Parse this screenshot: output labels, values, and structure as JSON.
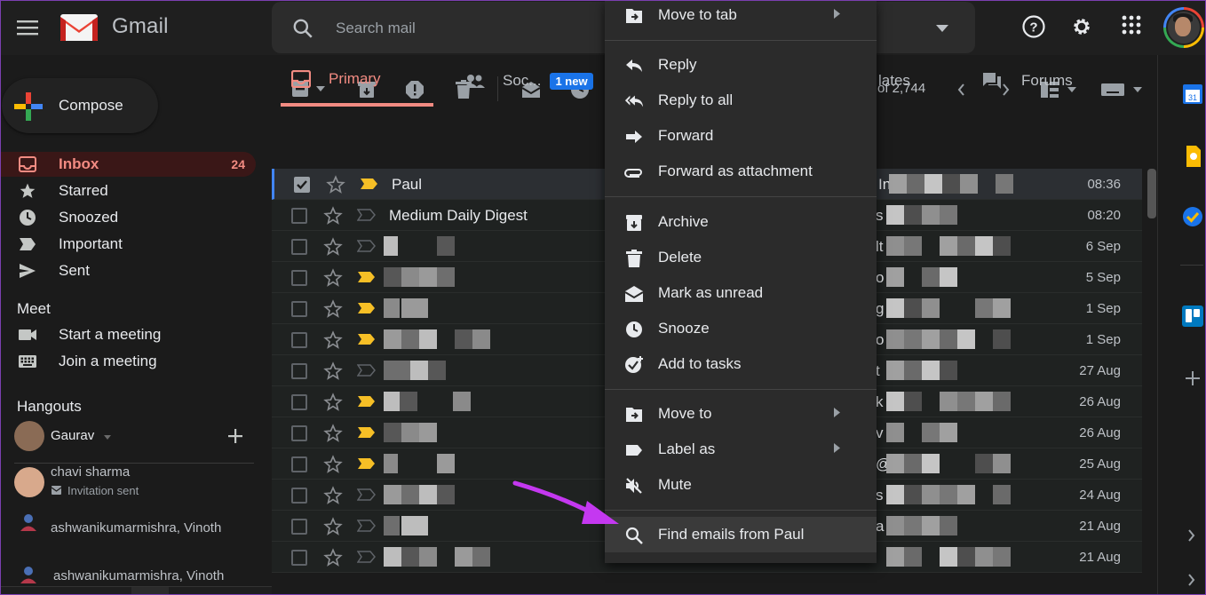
{
  "header": {
    "app_name": "Gmail",
    "search_placeholder": "Search mail"
  },
  "sidebar": {
    "compose_label": "Compose",
    "items": [
      {
        "label": "Inbox",
        "count": "24",
        "icon": "inbox-icon"
      },
      {
        "label": "Starred",
        "icon": "star-icon"
      },
      {
        "label": "Snoozed",
        "icon": "clock-icon"
      },
      {
        "label": "Important",
        "icon": "important-icon"
      },
      {
        "label": "Sent",
        "icon": "send-icon"
      }
    ],
    "meet": {
      "title": "Meet",
      "start": "Start a meeting",
      "join": "Join a meeting"
    },
    "hangouts": {
      "title": "Hangouts",
      "self": "Gaurav",
      "contacts": [
        {
          "name": "chavi sharma",
          "status": "Invitation sent"
        },
        {
          "name": "ashwanikumarmishra, Vinoth"
        },
        {
          "name": "ashwanikumarmishra, Vinoth"
        }
      ]
    }
  },
  "toolbar": {
    "page_count": "of 2,744"
  },
  "tabs": [
    {
      "label": "Primary",
      "active": true
    },
    {
      "label": "Soc...",
      "badge": "1 new"
    },
    {
      "label": "lates"
    },
    {
      "label": "Forums"
    }
  ],
  "emails": [
    {
      "sender": "Paul",
      "snippet_start": "In",
      "date": "08:36",
      "selected": true,
      "important": true
    },
    {
      "sender": "Medium Daily Digest",
      "snippet_start": "s",
      "date": "08:20",
      "important": false
    },
    {
      "sender": "",
      "snippet_start": "lt",
      "date": "6 Sep",
      "important": false
    },
    {
      "sender": "",
      "snippet_start": "o",
      "date": "5 Sep",
      "important": true
    },
    {
      "sender": "",
      "snippet_start": "g",
      "date": "1 Sep",
      "important": true
    },
    {
      "sender": "",
      "snippet_start": "o",
      "date": "1 Sep",
      "important": true
    },
    {
      "sender": "",
      "snippet_start": "t",
      "date": "27 Aug",
      "important": false
    },
    {
      "sender": "",
      "snippet_start": "k",
      "date": "26 Aug",
      "important": true
    },
    {
      "sender": "",
      "snippet_start": "v",
      "date": "26 Aug",
      "important": true
    },
    {
      "sender": "",
      "snippet_start": "@",
      "date": "25 Aug",
      "important": true
    },
    {
      "sender": "",
      "snippet_start": "s",
      "date": "24 Aug",
      "important": false
    },
    {
      "sender": "",
      "snippet_start": "a",
      "date": "21 Aug",
      "important": false
    },
    {
      "sender": "",
      "snippet_start": "",
      "date": "21 Aug",
      "important": false
    }
  ],
  "context_menu": {
    "items": [
      {
        "label": "Move to tab",
        "icon": "move-to-tab-icon",
        "submenu": true
      },
      {
        "label": "Reply",
        "icon": "reply-icon"
      },
      {
        "label": "Reply to all",
        "icon": "reply-all-icon"
      },
      {
        "label": "Forward",
        "icon": "forward-icon"
      },
      {
        "label": "Forward as attachment",
        "icon": "attachment-icon"
      },
      {
        "label": "Archive",
        "icon": "archive-icon"
      },
      {
        "label": "Delete",
        "icon": "trash-icon"
      },
      {
        "label": "Mark as unread",
        "icon": "mark-unread-icon"
      },
      {
        "label": "Snooze",
        "icon": "clock-icon"
      },
      {
        "label": "Add to tasks",
        "icon": "add-task-icon"
      },
      {
        "label": "Move to",
        "icon": "move-to-icon",
        "submenu": true
      },
      {
        "label": "Label as",
        "icon": "label-icon",
        "submenu": true
      },
      {
        "label": "Mute",
        "icon": "mute-icon"
      },
      {
        "label": "Find emails from Paul",
        "icon": "search-icon",
        "highlighted": true
      }
    ]
  },
  "colors": {
    "accent_red": "#f28b82",
    "important_yellow": "#f6bf26",
    "arrow_annotation": "#c438f0",
    "new_badge": "#1a73e8"
  }
}
